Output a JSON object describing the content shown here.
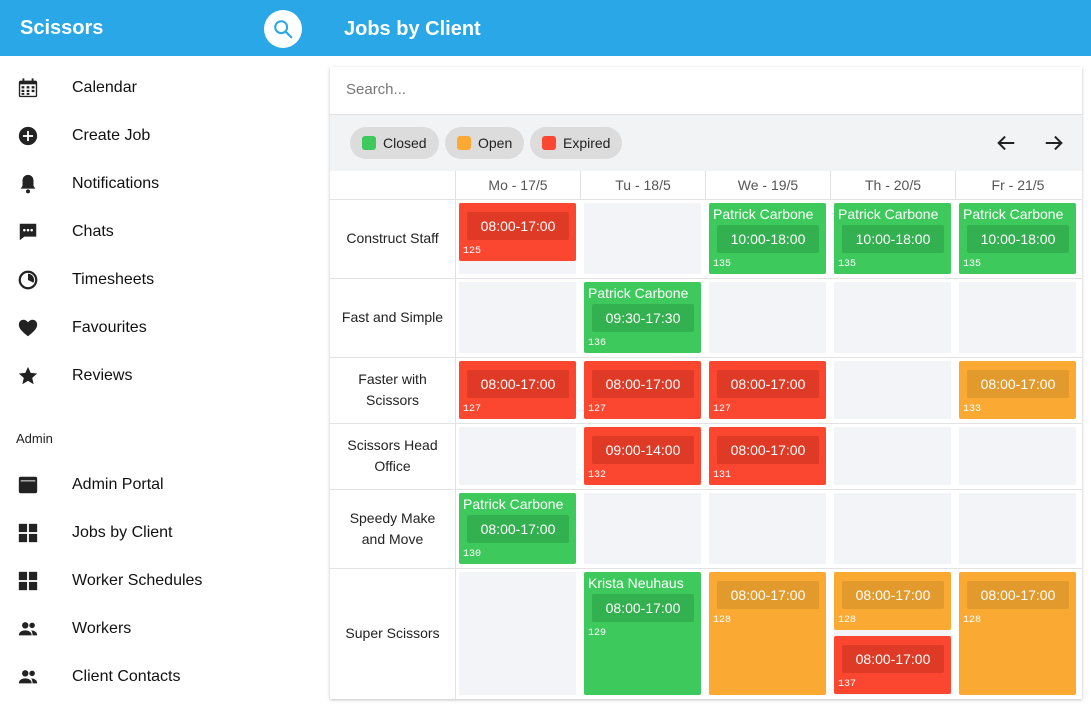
{
  "app": {
    "title": "Scissors",
    "page_title": "Jobs by Client"
  },
  "sidebar": {
    "items": [
      {
        "label": "Calendar",
        "icon": "calendar-icon"
      },
      {
        "label": "Create Job",
        "icon": "add-circle-icon"
      },
      {
        "label": "Notifications",
        "icon": "bell-icon"
      },
      {
        "label": "Chats",
        "icon": "chat-icon"
      },
      {
        "label": "Timesheets",
        "icon": "timer-icon"
      },
      {
        "label": "Favourites",
        "icon": "heart-icon"
      },
      {
        "label": "Reviews",
        "icon": "star-icon"
      }
    ],
    "admin_section": "Admin",
    "admin_items": [
      {
        "label": "Admin Portal",
        "icon": "window-icon"
      },
      {
        "label": "Jobs by Client",
        "icon": "grid-icon"
      },
      {
        "label": "Worker Schedules",
        "icon": "grid-icon"
      },
      {
        "label": "Workers",
        "icon": "people-icon"
      },
      {
        "label": "Client Contacts",
        "icon": "people-icon"
      }
    ]
  },
  "search": {
    "placeholder": "Search..."
  },
  "filters": [
    {
      "label": "Closed",
      "color": "#3ec95c"
    },
    {
      "label": "Open",
      "color": "#faa933"
    },
    {
      "label": "Expired",
      "color": "#fb4630"
    }
  ],
  "days": [
    "Mo - 17/5",
    "Tu - 18/5",
    "We - 19/5",
    "Th - 20/5",
    "Fr - 21/5"
  ],
  "clients": [
    {
      "name": "Construct Staff",
      "jobs": [
        {
          "day": 0,
          "status": "expired",
          "time": "08:00-17:00",
          "id": "125"
        },
        {
          "day": 2,
          "status": "closed",
          "worker": "Patrick Carbone",
          "time": "10:00-18:00",
          "id": "135"
        },
        {
          "day": 3,
          "status": "closed",
          "worker": "Patrick Carbone",
          "time": "10:00-18:00",
          "id": "135"
        },
        {
          "day": 4,
          "status": "closed",
          "worker": "Patrick Carbone",
          "time": "10:00-18:00",
          "id": "135"
        }
      ]
    },
    {
      "name": "Fast and Simple",
      "jobs": [
        {
          "day": 1,
          "status": "closed",
          "worker": "Patrick Carbone",
          "time": "09:30-17:30",
          "id": "136"
        }
      ]
    },
    {
      "name": "Faster with Scissors",
      "jobs": [
        {
          "day": 0,
          "status": "expired",
          "time": "08:00-17:00",
          "id": "127"
        },
        {
          "day": 1,
          "status": "expired",
          "time": "08:00-17:00",
          "id": "127"
        },
        {
          "day": 2,
          "status": "expired",
          "time": "08:00-17:00",
          "id": "127"
        },
        {
          "day": 4,
          "status": "open",
          "time": "08:00-17:00",
          "id": "133"
        }
      ]
    },
    {
      "name": "Scissors Head Office",
      "jobs": [
        {
          "day": 1,
          "status": "expired",
          "time": "09:00-14:00",
          "id": "132"
        },
        {
          "day": 2,
          "status": "expired",
          "time": "08:00-17:00",
          "id": "131"
        }
      ]
    },
    {
      "name": "Speedy Make and Move",
      "jobs": [
        {
          "day": 0,
          "status": "closed",
          "worker": "Patrick Carbone",
          "time": "08:00-17:00",
          "id": "130"
        }
      ]
    },
    {
      "name": "Super Scissors",
      "jobs": [
        {
          "day": 1,
          "status": "closed",
          "worker": "Krista Neuhaus",
          "time": "08:00-17:00",
          "id": "129"
        },
        {
          "day": 2,
          "status": "open",
          "time": "08:00-17:00",
          "id": "128"
        },
        {
          "day": 3,
          "status": "open",
          "time": "08:00-17:00",
          "id": "128"
        },
        {
          "day": 3,
          "status": "expired",
          "time": "08:00-17:00",
          "id": "137"
        },
        {
          "day": 4,
          "status": "open",
          "time": "08:00-17:00",
          "id": "128"
        }
      ]
    }
  ]
}
